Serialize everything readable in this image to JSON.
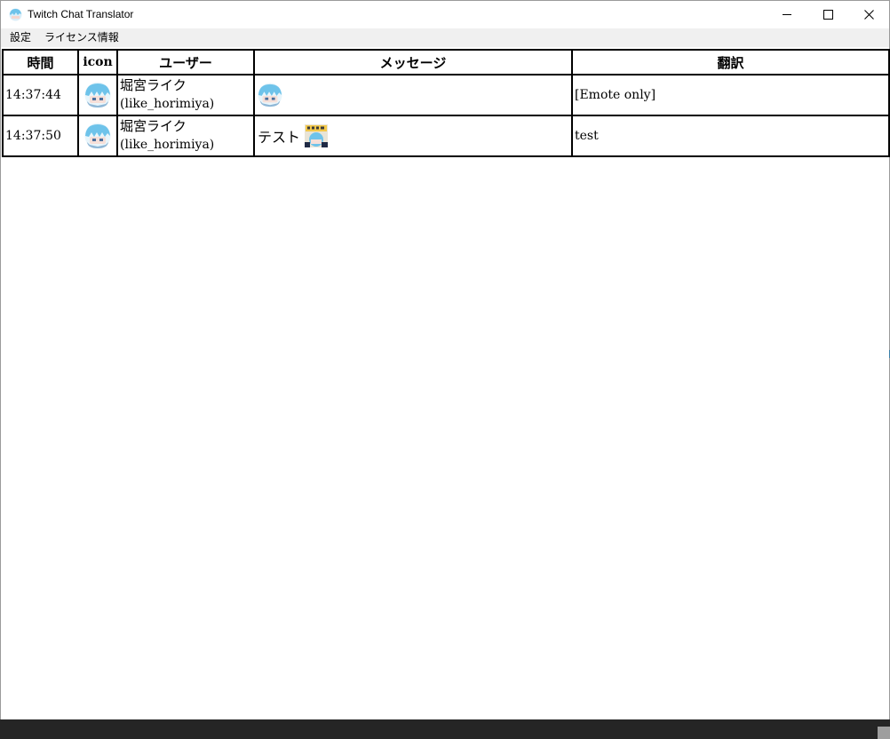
{
  "window": {
    "title": "Twitch Chat Translator",
    "controls": {
      "minimize": "minimize-icon",
      "maximize": "maximize-icon",
      "close": "close-icon"
    }
  },
  "menu": {
    "settings": "設定",
    "license": "ライセンス情報"
  },
  "table": {
    "headers": {
      "time": "時間",
      "icon": "icon",
      "user": "ユーザー",
      "message": "メッセージ",
      "translation": "翻訳"
    },
    "rows": [
      {
        "time": "14:37:44",
        "display_name": "堀宮ライク",
        "login": "(like_horimiya)",
        "message_text": "",
        "translation": "[Emote only]"
      },
      {
        "time": "14:37:50",
        "display_name": "堀宮ライク",
        "login": "(like_horimiya)",
        "message_text": "テスト",
        "translation": "test"
      }
    ]
  },
  "colors": {
    "titlebar": "#ffffff",
    "menubar": "#f0f0f0",
    "table_border": "#000000",
    "bottom_strip": "#252525",
    "avatar_hair": "#6ec3ea"
  }
}
